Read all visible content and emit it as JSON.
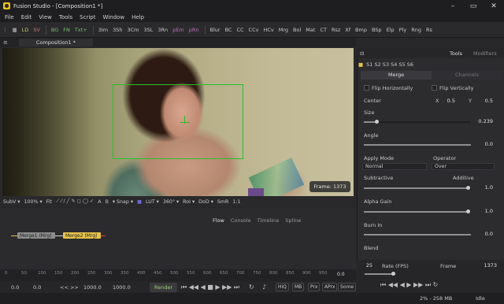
{
  "window": {
    "title": "Fusion Studio - [Composition1 *]",
    "controls": [
      "–",
      "▭",
      "✕"
    ]
  },
  "menu": [
    "File",
    "Edit",
    "View",
    "Tools",
    "Script",
    "Window",
    "Help"
  ],
  "toolbar": [
    "LD",
    "SV",
    "BG",
    "FN",
    "Txt+",
    "3Im",
    "3Sh",
    "3Cm",
    "3SL",
    "3Rn",
    "pEm",
    "pRn",
    "Blur",
    "BC",
    "CC",
    "CCv",
    "HCv",
    "Mrg",
    "Bol",
    "Mat",
    "CT",
    "Rsz",
    "Xf",
    "Bmp",
    "BSp",
    "Elp",
    "Ply",
    "Rng",
    "Rs"
  ],
  "doc_tab": "Composition1 *",
  "viewer": {
    "frame_label": "Frame: 1373"
  },
  "viewer_bar": [
    "SubV ▾",
    "100% ▾",
    "Fit",
    "▾ Snap ▾",
    "LUT ▾",
    "360° ▾",
    "RoI ▾",
    "DoD ▾",
    "SmR",
    "1:1"
  ],
  "flow_tabs": {
    "flow": "Flow",
    "console": "Console",
    "timeline": "Timeline",
    "spline": "Spline"
  },
  "nodes": {
    "merge1": "Merge1 (Mrg)",
    "merge2": "Merge2 (Mrg)"
  },
  "timeline": {
    "ticks": [
      "0",
      "50",
      "100",
      "150",
      "200",
      "250",
      "300",
      "350",
      "400",
      "450",
      "500",
      "550",
      "600",
      "650",
      "700",
      "750",
      "800",
      "850",
      "900",
      "950"
    ],
    "end_value": "0.0"
  },
  "playback": {
    "start": "0.0",
    "render_start": "0.0",
    "nav": "<< >>",
    "render_end": "1000.0",
    "end": "1000.0",
    "render": "Render",
    "hiq": "HiQ",
    "mb": "MB",
    "prx": "Prx",
    "aprx": "APrx",
    "some": "Some"
  },
  "right_panel": {
    "tabs_left": "S1 S2 S3 S4 S5 S6",
    "tools_tab": "Tools",
    "modifiers_tab": "Modifiers",
    "merge_tab": "Merge",
    "channels_tab": "Channels",
    "flip_h": "Flip Horizontally",
    "flip_v": "Flip Vertically",
    "center_label": "Center",
    "x_label": "X",
    "x_value": "0.5",
    "y_label": "Y",
    "y_value": "0.5",
    "size_label": "Size",
    "size_value": "0.239",
    "size_fraction": 0.12,
    "angle_label": "Angle",
    "angle_value": "0.0",
    "apply_mode_label": "Apply Mode",
    "apply_mode_value": "Normal",
    "operator_label": "Operator",
    "operator_value": "Over",
    "subtractive_label": "Subtractive",
    "additive_label": "Additive",
    "sub_add_value": "1.0",
    "gain_label": "Alpha Gain",
    "gain_value": "1.0",
    "burn_label": "Burn In",
    "burn_value": "0.0",
    "blend_label": "Blend",
    "fps_value": "25",
    "fps_label": "Rate (FPS)",
    "frame_label": "Frame",
    "frame_value": "1373"
  },
  "status": {
    "memory": "2% - 258 MB",
    "state": "Idle"
  }
}
